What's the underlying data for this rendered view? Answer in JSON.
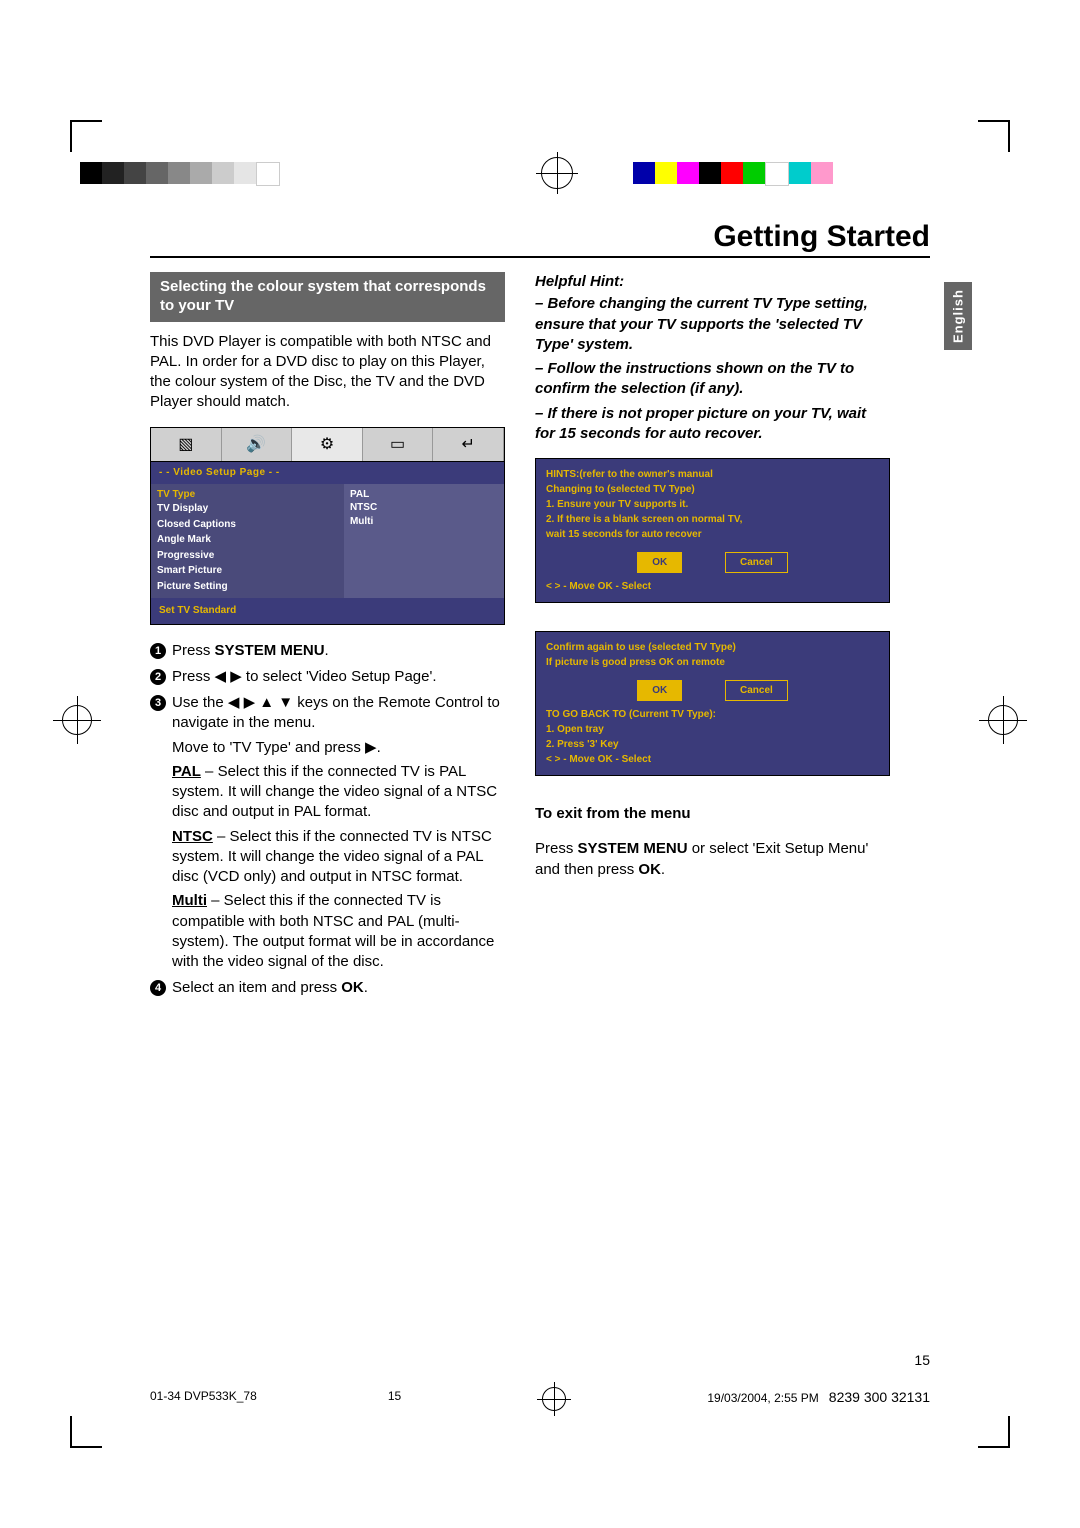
{
  "title": "Getting Started",
  "language_tab": "English",
  "section_heading": "Selecting the colour system that corresponds to your TV",
  "intro": "This DVD Player is compatible with both NTSC and PAL. In order for a DVD disc to play on this Player, the colour system of the Disc, the TV and the DVD Player should match.",
  "osd": {
    "bar": "- - Video Setup Page - -",
    "items": [
      "TV Type",
      "TV Display",
      "Closed Captions",
      "Angle Mark",
      "Progressive",
      "Smart Picture",
      "Picture Setting"
    ],
    "options": [
      "PAL",
      "NTSC",
      "Multi"
    ],
    "footer": "Set TV Standard"
  },
  "steps": {
    "s1_a": "Press ",
    "s1_b": "SYSTEM MENU",
    "s1_c": ".",
    "s2": "Press ◀ ▶ to select 'Video Setup Page'.",
    "s3a": "Use the ◀ ▶ ▲ ▼ keys on the Remote Control to navigate in the menu.",
    "s3b": "Move to 'TV Type' and press ▶.",
    "pal_label": "PAL",
    "pal_text": " – Select this if the connected TV is PAL system. It will change the video signal of a NTSC disc and output in PAL format.",
    "ntsc_label": "NTSC",
    "ntsc_text": " – Select this if the connected TV is NTSC system. It will change the video signal of a PAL disc (VCD only) and output in NTSC format.",
    "multi_label": "Multi",
    "multi_text": " – Select this if the connected TV is compatible with both NTSC and PAL (multi-system). The output format will be in accordance with the video signal of the disc.",
    "s4_a": "Select an item and press ",
    "s4_b": "OK",
    "s4_c": "."
  },
  "hints": {
    "head": "Helpful Hint:",
    "h1": "–   Before changing the current TV Type setting, ensure that your TV supports the 'selected TV Type' system.",
    "h2": "–   Follow the instructions shown on the TV to confirm the selection (if any).",
    "h3": "–   If there is not proper picture on your TV, wait for 15 seconds for auto recover."
  },
  "osd_hint1": {
    "l1": "HINTS:(refer to the owner's manual",
    "l2": "Changing to (selected TV Type)",
    "l3": "1. Ensure your TV supports it.",
    "l4": "2. If there is a blank screen on normal TV,",
    "l5": "    wait 15 seconds for auto recover",
    "ok": "OK",
    "cancel": "Cancel",
    "nav": "<  >  -  Move    OK  -  Select"
  },
  "osd_hint2": {
    "l1": "Confirm again to use (selected TV Type)",
    "l2": "If picture is good press OK on remote",
    "ok": "OK",
    "cancel": "Cancel",
    "l3": "TO GO BACK TO (Current TV Type):",
    "l4": "1. Open tray",
    "l5": "2. Press '3' Key",
    "nav": "<  >  -  Move    OK  -  Select"
  },
  "exit": {
    "head": "To exit from the menu",
    "t1": "Press ",
    "t2": "SYSTEM MENU",
    "t3": " or select 'Exit Setup Menu' and then press ",
    "t4": "OK",
    "t5": "."
  },
  "page_number": "15",
  "footer": {
    "left": "01-34 DVP533K_78",
    "mid": "15",
    "date": "19/03/2004, 2:55 PM",
    "right": "8239 300 32131"
  }
}
